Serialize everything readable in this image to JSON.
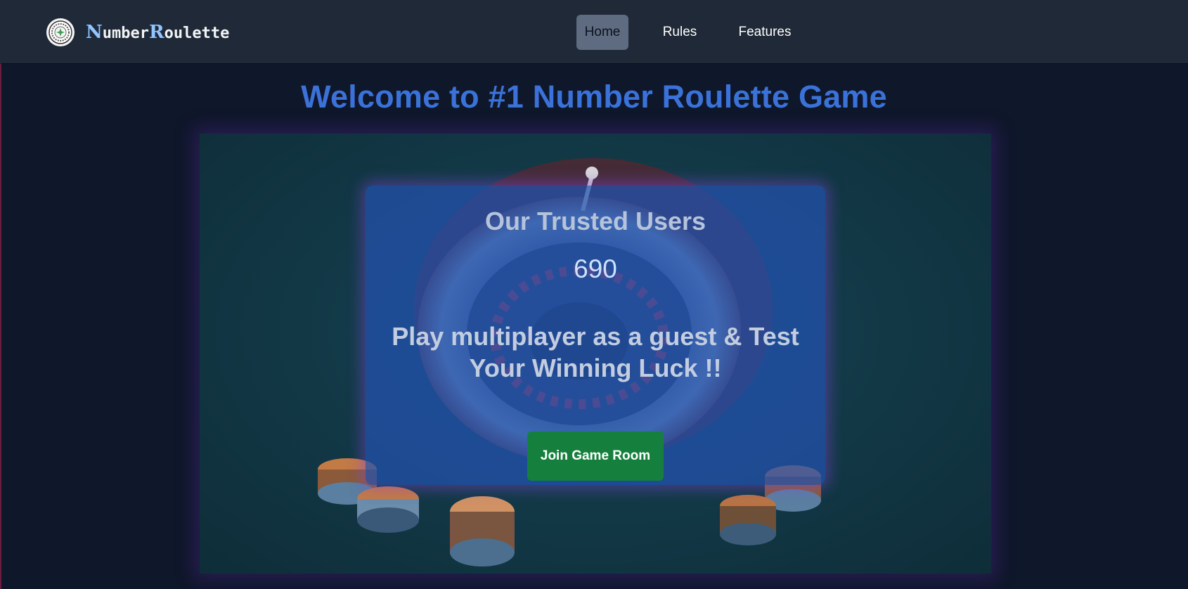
{
  "brand": {
    "first_cap": "N",
    "middle": "umber",
    "second_cap": "R",
    "end": "oulette",
    "logo_icon": "roulette-wheel-icon"
  },
  "nav": {
    "items": [
      {
        "label": "Home",
        "active": true
      },
      {
        "label": "Rules"
      },
      {
        "label": "Features"
      }
    ]
  },
  "main": {
    "headline": "Welcome to #1 Number Roulette Game",
    "card": {
      "title": "Our Trusted Users",
      "user_count": "690",
      "tagline": "Play multiplayer as a guest & Test Your Winning Luck !!",
      "join_button": "Join Game Room"
    }
  },
  "colors": {
    "page_bg": "#0f172a",
    "nav_bg": "#1f2937",
    "headline": "#3b72d9",
    "card_bg": "#2352b0",
    "button": "#15803d"
  }
}
